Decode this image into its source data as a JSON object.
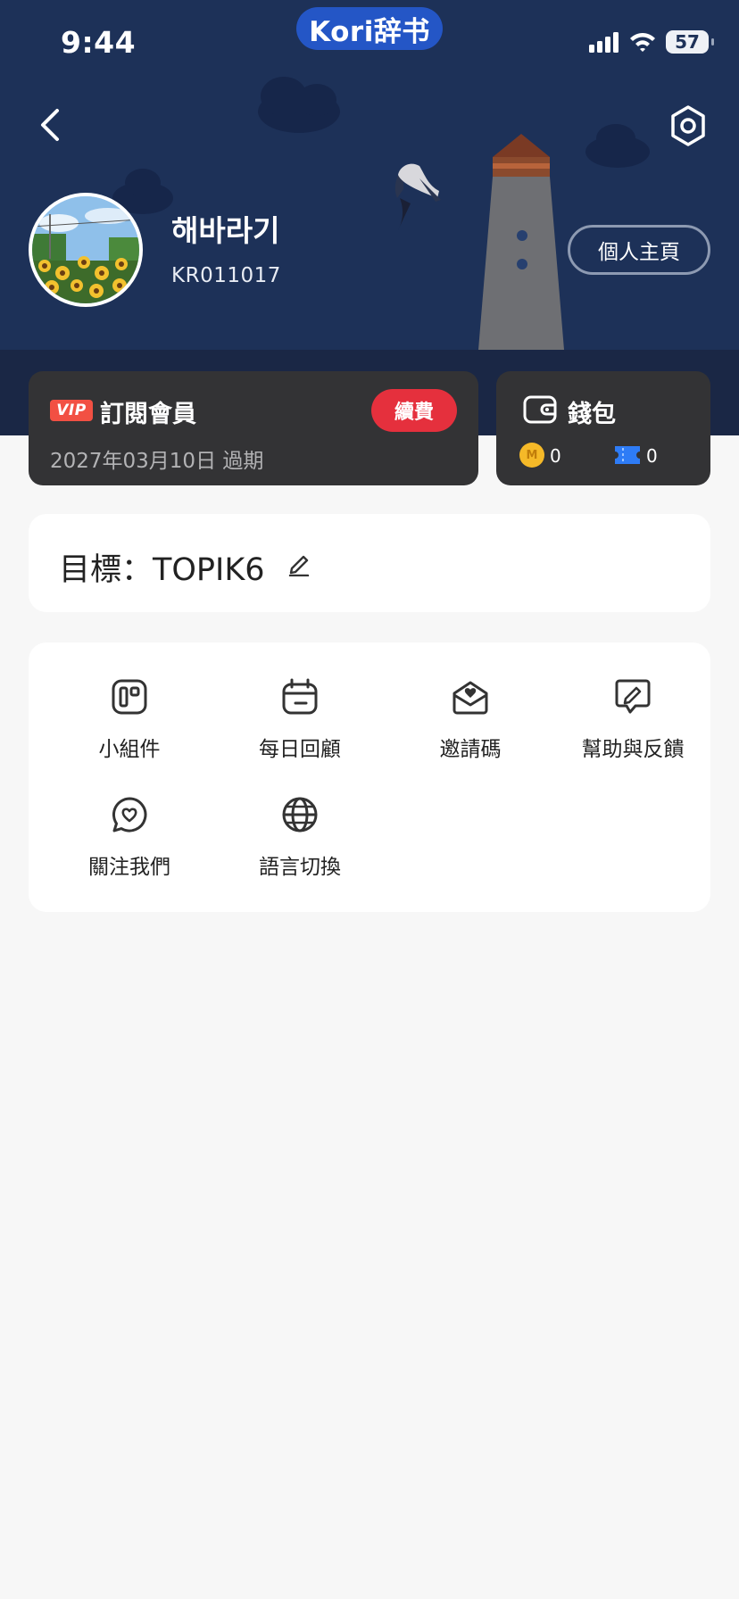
{
  "status_bar": {
    "time": "9:44",
    "app_label": "Kori辞书",
    "battery": "57"
  },
  "profile": {
    "name": "해바라기",
    "user_id": "KR011017",
    "home_button": "個人主頁"
  },
  "vip": {
    "badge": "VIP",
    "title": "訂閱會員",
    "renew_button": "續費",
    "expiry": "2027年03月10日 過期"
  },
  "wallet": {
    "title": "錢包",
    "coin_symbol": "M",
    "coins": "0",
    "tickets": "0"
  },
  "goal": {
    "text": "目標：TOPIK6"
  },
  "menu": {
    "items": [
      {
        "label": "小組件",
        "icon": "widget-icon"
      },
      {
        "label": "每日回顧",
        "icon": "calendar-icon"
      },
      {
        "label": "邀請碼",
        "icon": "invite-icon"
      },
      {
        "label": "幫助與反饋",
        "icon": "feedback-icon"
      },
      {
        "label": "關注我們",
        "icon": "heart-chat-icon"
      },
      {
        "label": "語言切換",
        "icon": "globe-icon"
      }
    ]
  },
  "colors": {
    "header_bg": "#1d3158",
    "card_dark": "#333335",
    "renew_red": "#e5303d",
    "app_pill_blue": "#2456c6"
  }
}
